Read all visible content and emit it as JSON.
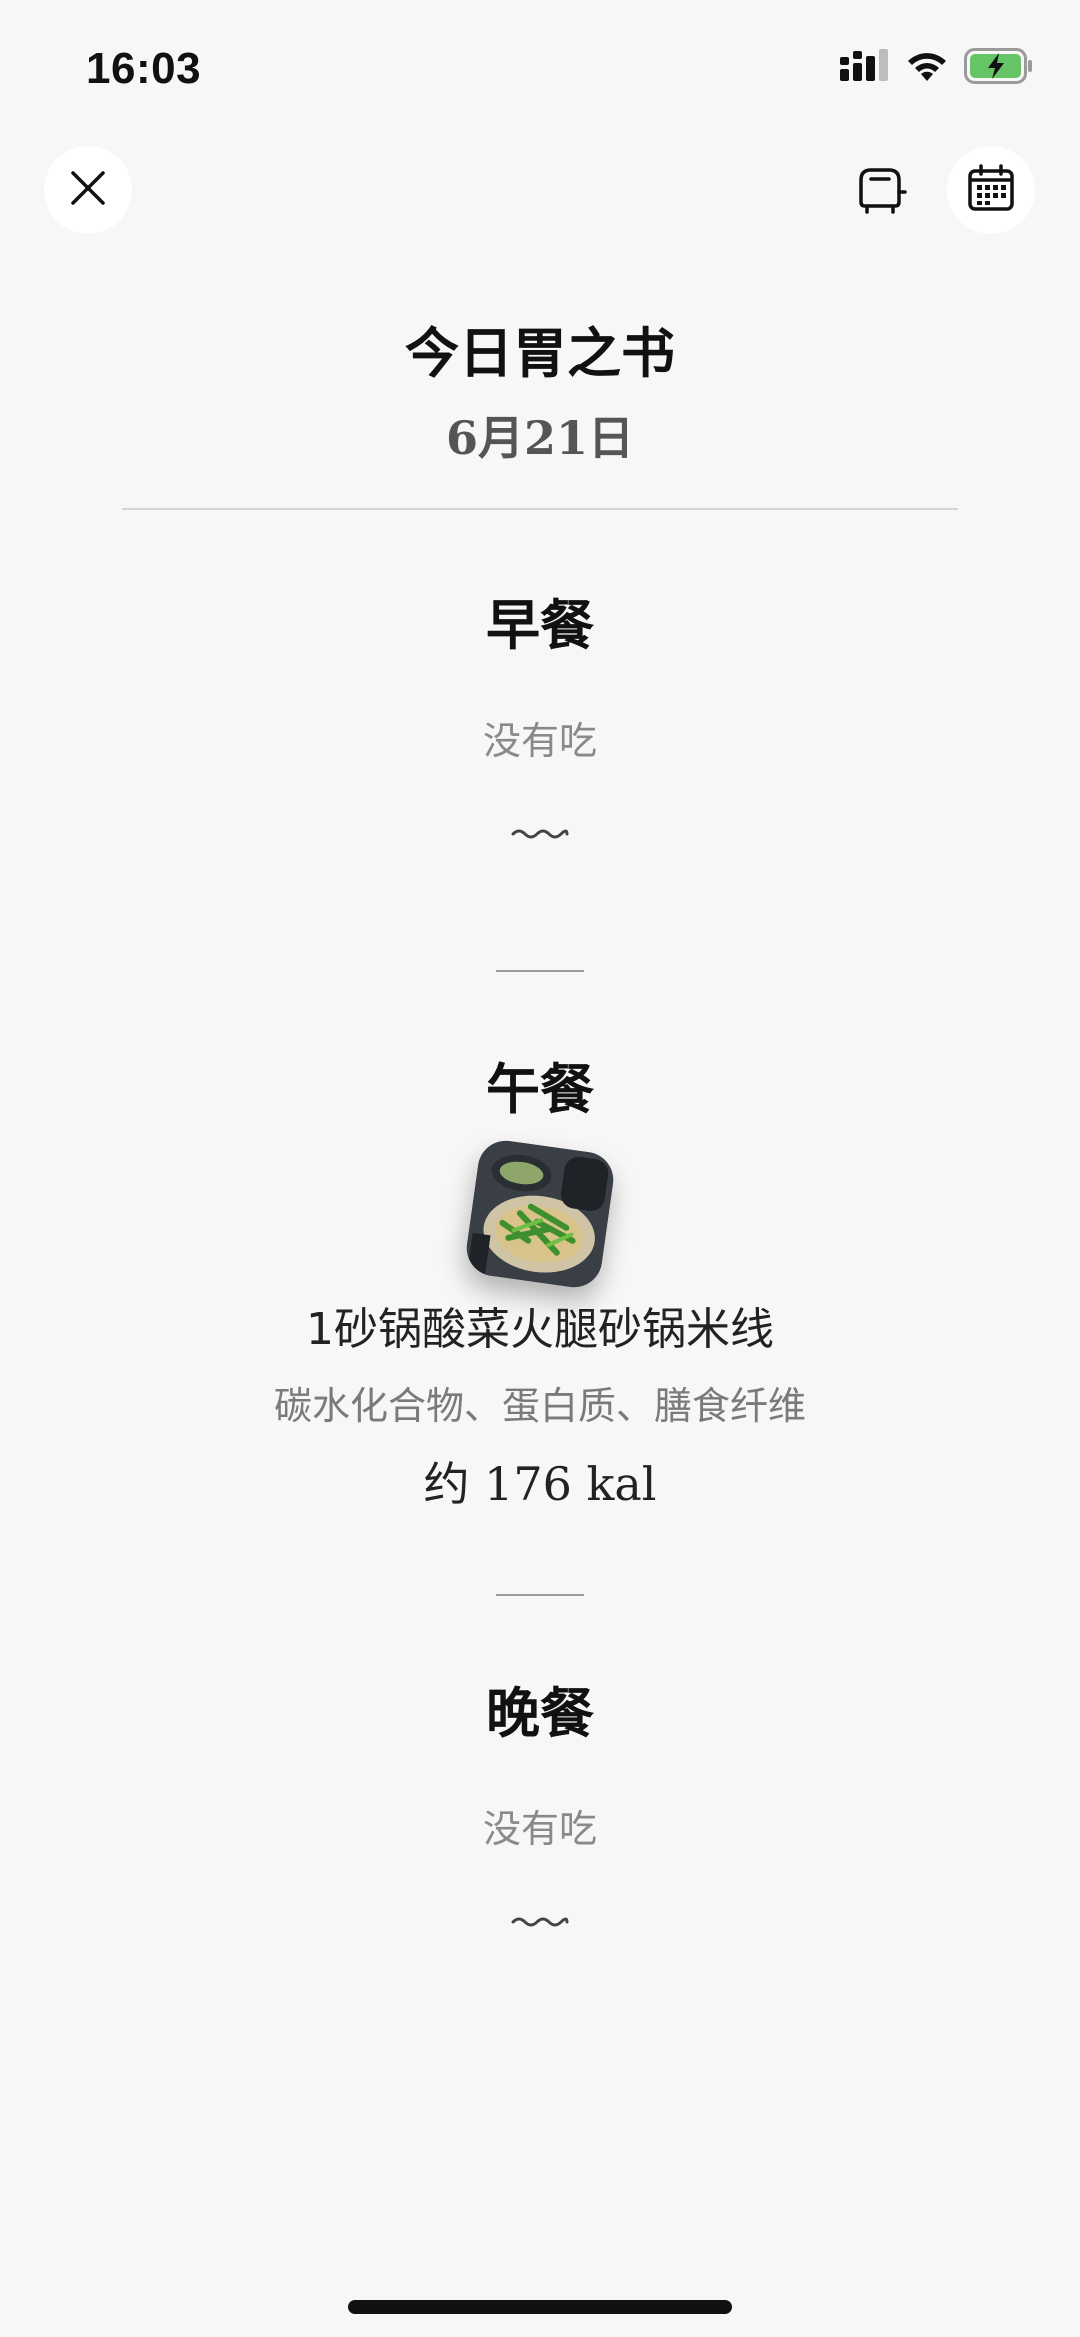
{
  "status_bar": {
    "time": "16:03",
    "icons": [
      "cellular-signal-icon",
      "wifi-icon",
      "battery-charging-icon"
    ]
  },
  "toolbar": {
    "close_icon": "close-icon",
    "toaster_icon": "toaster-icon",
    "calendar_icon": "calendar-icon"
  },
  "header": {
    "title": "今日胃之书",
    "date": "6月21日"
  },
  "meals": {
    "breakfast": {
      "title": "早餐",
      "empty_text": "没有吃"
    },
    "lunch": {
      "title": "午餐",
      "items": [
        {
          "name": "1砂锅酸菜火腿砂锅米线",
          "nutrients": "碳水化合物、蛋白质、膳食纤维",
          "calories": "约 176 kal"
        }
      ]
    },
    "dinner": {
      "title": "晚餐",
      "empty_text": "没有吃"
    }
  },
  "colors": {
    "background": "#f7f7f7",
    "battery_fill": "#65c466",
    "muted_text": "#8a8a8a"
  }
}
